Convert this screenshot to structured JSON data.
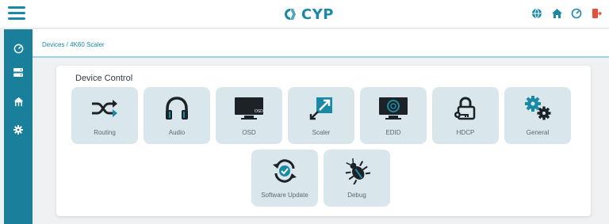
{
  "header": {
    "brand": "CYP",
    "icons": [
      "globe-icon",
      "home-icon",
      "gauge-icon",
      "logout-icon"
    ]
  },
  "sidebar": {
    "items": [
      "dashboard-icon",
      "devices-icon",
      "network-icon",
      "settings-icon"
    ]
  },
  "breadcrumb": "Devices / 4K60 Scaler",
  "panel": {
    "title": "Device Control",
    "tiles": [
      {
        "label": "Routing",
        "icon": "shuffle-icon"
      },
      {
        "label": "Audio",
        "icon": "headphones-icon"
      },
      {
        "label": "OSD",
        "icon": "monitor-osd-icon"
      },
      {
        "label": "Scaler",
        "icon": "scale-arrows-icon"
      },
      {
        "label": "EDID",
        "icon": "monitor-edid-icon"
      },
      {
        "label": "HDCP",
        "icon": "lock-key-icon"
      },
      {
        "label": "General",
        "icon": "gears-icon"
      },
      {
        "label": "Software Update",
        "icon": "update-icon"
      },
      {
        "label": "Debug",
        "icon": "bug-icon"
      }
    ],
    "monitor_texts": {
      "osd": "OSD"
    }
  },
  "colors": {
    "accent": "#1a89a6",
    "sidebar": "#1a7f9a",
    "tile": "#d9e6ec",
    "icon_dark": "#1d2226",
    "icon_teal": "#1a89a6"
  }
}
